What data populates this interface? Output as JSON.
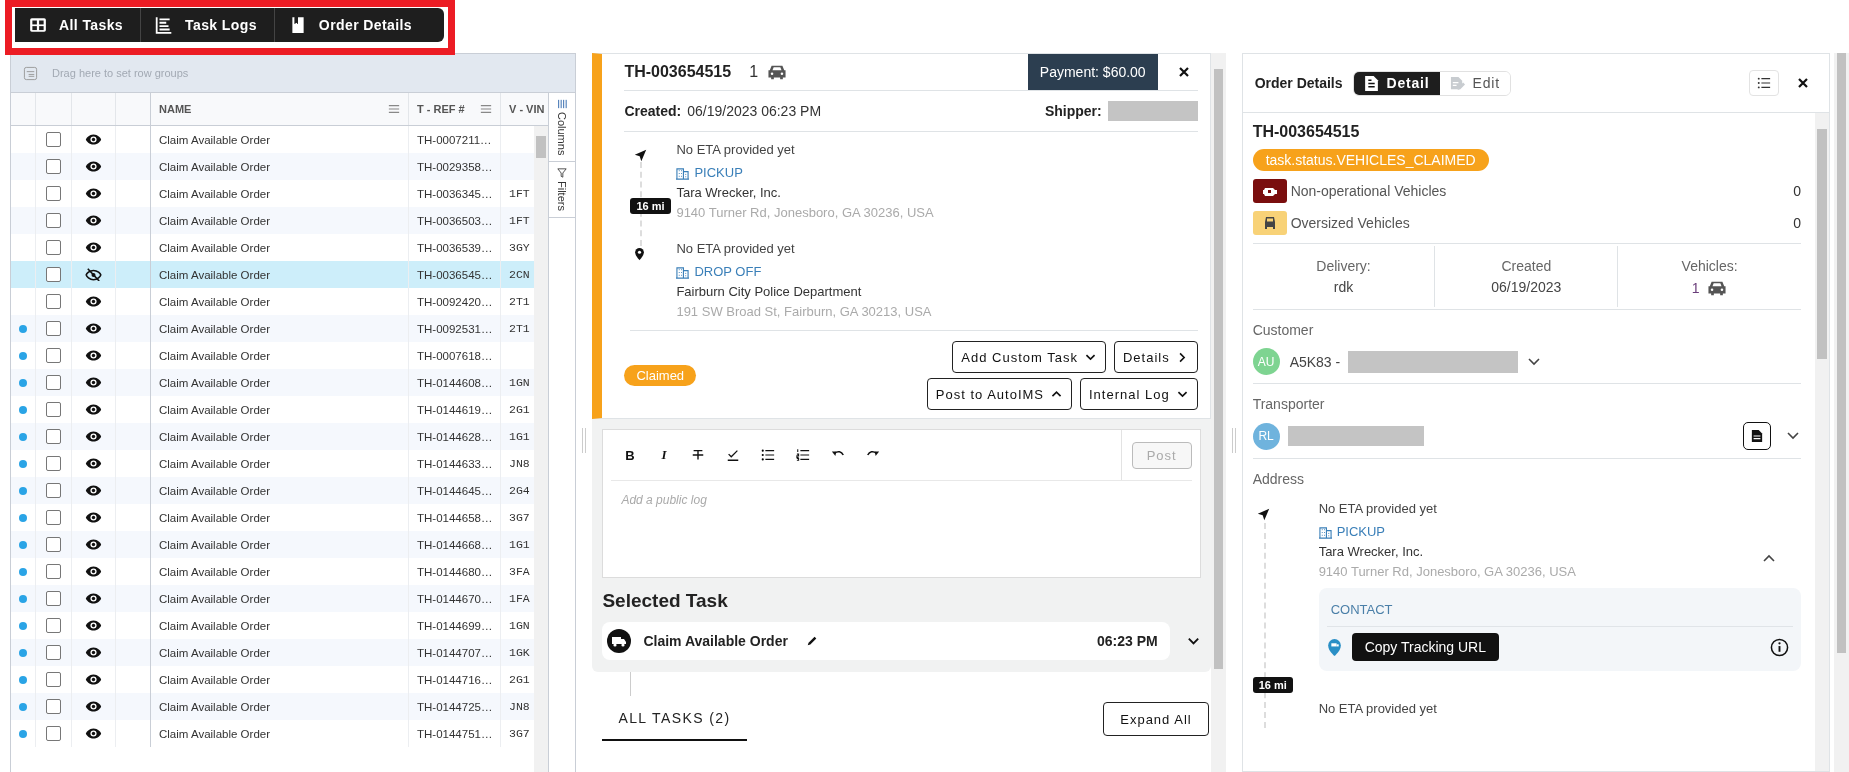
{
  "top_tabs": [
    {
      "label": "All Tasks",
      "kind": "table"
    },
    {
      "label": "Task Logs",
      "kind": "logs"
    },
    {
      "label": "Order Details",
      "kind": "bookmark"
    }
  ],
  "grid": {
    "group_bar_placeholder": "Drag here to set row groups",
    "columns": [
      "NAME",
      "T - REF #",
      "V - VIN"
    ],
    "side_tabs": [
      "Columns",
      "Filters"
    ],
    "rows": [
      {
        "unread": false,
        "checked": false,
        "visible": true,
        "selected": false,
        "name": "Claim Available Order",
        "ref": "TH-0007211…"
      },
      {
        "unread": false,
        "checked": false,
        "visible": true,
        "selected": false,
        "name": "Claim Available Order",
        "ref": "TH-0029358…"
      },
      {
        "unread": false,
        "checked": false,
        "visible": true,
        "selected": false,
        "name": "Claim Available Order",
        "ref": "TH-0036345…",
        "vin": "1FT"
      },
      {
        "unread": false,
        "checked": false,
        "visible": true,
        "selected": false,
        "name": "Claim Available Order",
        "ref": "TH-0036503…",
        "vin": "1FT"
      },
      {
        "unread": false,
        "checked": false,
        "visible": true,
        "selected": false,
        "name": "Claim Available Order",
        "ref": "TH-0036539…",
        "vin": "3GY"
      },
      {
        "unread": false,
        "checked": false,
        "visible": false,
        "selected": true,
        "name": "Claim Available Order",
        "ref": "TH-0036545…",
        "vin": "2CN"
      },
      {
        "unread": false,
        "checked": false,
        "visible": true,
        "selected": false,
        "name": "Claim Available Order",
        "ref": "TH-0092420…",
        "vin": "2T1"
      },
      {
        "unread": true,
        "checked": false,
        "visible": true,
        "selected": false,
        "name": "Claim Available Order",
        "ref": "TH-0092531…",
        "vin": "2T1"
      },
      {
        "unread": true,
        "checked": false,
        "visible": true,
        "selected": false,
        "name": "Claim Available Order",
        "ref": "TH-0007618…"
      },
      {
        "unread": true,
        "checked": false,
        "visible": true,
        "selected": false,
        "name": "Claim Available Order",
        "ref": "TH-0144608…",
        "vin": "1GN"
      },
      {
        "unread": true,
        "checked": false,
        "visible": true,
        "selected": false,
        "name": "Claim Available Order",
        "ref": "TH-0144619…",
        "vin": "2G1"
      },
      {
        "unread": true,
        "checked": false,
        "visible": true,
        "selected": false,
        "name": "Claim Available Order",
        "ref": "TH-0144628…",
        "vin": "1G1"
      },
      {
        "unread": true,
        "checked": false,
        "visible": true,
        "selected": false,
        "name": "Claim Available Order",
        "ref": "TH-0144633…",
        "vin": "JN8"
      },
      {
        "unread": true,
        "checked": false,
        "visible": true,
        "selected": false,
        "name": "Claim Available Order",
        "ref": "TH-0144645…",
        "vin": "2G4"
      },
      {
        "unread": true,
        "checked": false,
        "visible": true,
        "selected": false,
        "name": "Claim Available Order",
        "ref": "TH-0144658…",
        "vin": "3G7"
      },
      {
        "unread": true,
        "checked": false,
        "visible": true,
        "selected": false,
        "name": "Claim Available Order",
        "ref": "TH-0144668…",
        "vin": "1G1"
      },
      {
        "unread": true,
        "checked": false,
        "visible": true,
        "selected": false,
        "name": "Claim Available Order",
        "ref": "TH-0144680…",
        "vin": "3FA"
      },
      {
        "unread": true,
        "checked": false,
        "visible": true,
        "selected": false,
        "name": "Claim Available Order",
        "ref": "TH-0144670…",
        "vin": "1FA"
      },
      {
        "unread": true,
        "checked": false,
        "visible": true,
        "selected": false,
        "name": "Claim Available Order",
        "ref": "TH-0144699…",
        "vin": "1GN"
      },
      {
        "unread": true,
        "checked": false,
        "visible": true,
        "selected": false,
        "name": "Claim Available Order",
        "ref": "TH-0144707…",
        "vin": "1GK"
      },
      {
        "unread": true,
        "checked": false,
        "visible": true,
        "selected": false,
        "name": "Claim Available Order",
        "ref": "TH-0144716…",
        "vin": "2G1"
      },
      {
        "unread": true,
        "checked": false,
        "visible": true,
        "selected": false,
        "name": "Claim Available Order",
        "ref": "TH-0144725…",
        "vin": "JN8"
      },
      {
        "unread": true,
        "checked": false,
        "visible": true,
        "selected": false,
        "name": "Claim Available Order",
        "ref": "TH-0144751…",
        "vin": "3G7"
      }
    ]
  },
  "order_card": {
    "id": "TH-003654515",
    "vehicle_count": "1",
    "payment": "Payment: $60.00",
    "created_label": "Created:",
    "created": "06/19/2023 06:23 PM",
    "shipper_label": "Shipper:",
    "distance": "16 mi",
    "stops": [
      {
        "kind": "pickup",
        "eta": "No ETA provided yet",
        "type": "PICKUP",
        "name": "Tara Wrecker, Inc.",
        "address": "9140 Turner Rd, Jonesboro, GA 30236, USA"
      },
      {
        "kind": "dropoff",
        "eta": "No ETA provided yet",
        "type": "DROP OFF",
        "name": "Fairburn City Police Department",
        "address": "191 SW Broad St, Fairburn, GA 30213, USA"
      }
    ],
    "status": "Claimed",
    "actions": [
      [
        {
          "label": "Add Custom Task",
          "kind": "dropdown"
        },
        {
          "label": "Details",
          "kind": "link"
        }
      ],
      [
        {
          "label": "Post to AutoIMS",
          "kind": "dropup"
        },
        {
          "label": "Internal Log",
          "kind": "dropdown"
        }
      ]
    ]
  },
  "editor": {
    "tools": [
      {
        "kind": "bold",
        "glyph": "B"
      },
      {
        "kind": "italic",
        "glyph": "I"
      },
      {
        "kind": "strike"
      },
      {
        "kind": "check"
      },
      {
        "kind": "bullets"
      },
      {
        "kind": "numbers"
      },
      {
        "kind": "undo"
      },
      {
        "kind": "redo"
      }
    ],
    "post": "Post",
    "post_disabled": true,
    "placeholder": "Add a public log"
  },
  "selected_task": {
    "heading": "Selected Task",
    "name": "Claim Available Order",
    "time": "06:23 PM"
  },
  "all_tasks": {
    "tab": "ALL TASKS (2)",
    "selected": true,
    "expand_all": "Expand All"
  },
  "order_details": {
    "title": "Order Details",
    "modes": [
      {
        "label": "Detail",
        "kind": "detail",
        "selected": true
      },
      {
        "label": "Edit",
        "kind": "edit",
        "selected": false
      }
    ],
    "id": "TH-003654515",
    "status": "task.status.VEHICLES_CLAIMED",
    "flags": [
      {
        "kind": "non_operational",
        "label": "Non-operational Vehicles",
        "count": "0"
      },
      {
        "kind": "oversized",
        "label": "Oversized Vehicles",
        "count": "0"
      }
    ],
    "stats": [
      {
        "label": "Delivery:",
        "value": "rdk",
        "kind": "text"
      },
      {
        "label": "Created",
        "value": "06/19/2023",
        "kind": "text"
      },
      {
        "label": "Vehicles:",
        "value": "1",
        "kind": "vehicles"
      }
    ],
    "customer": {
      "label": "Customer",
      "initials": "AU",
      "name": "A5K83 -"
    },
    "transporter": {
      "label": "Transporter",
      "initials": "RL"
    },
    "address": {
      "label": "Address",
      "stop": {
        "eta": "No ETA provided yet",
        "type": "PICKUP",
        "name": "Tara Wrecker, Inc.",
        "address": "9140 Turner Rd, Jonesboro, GA 30236, USA",
        "expanded": true
      },
      "contact_label": "CONTACT",
      "copy_button": "Copy Tracking URL",
      "distance": "16 mi",
      "next_eta": "No ETA provided yet"
    }
  }
}
